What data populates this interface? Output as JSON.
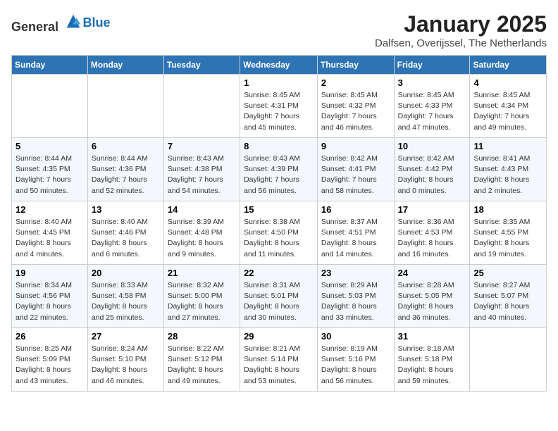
{
  "logo": {
    "general": "General",
    "blue": "Blue"
  },
  "title": "January 2025",
  "location": "Dalfsen, Overijssel, The Netherlands",
  "weekdays": [
    "Sunday",
    "Monday",
    "Tuesday",
    "Wednesday",
    "Thursday",
    "Friday",
    "Saturday"
  ],
  "weeks": [
    [
      {
        "day": "",
        "info": ""
      },
      {
        "day": "",
        "info": ""
      },
      {
        "day": "",
        "info": ""
      },
      {
        "day": "1",
        "info": "Sunrise: 8:45 AM\nSunset: 4:31 PM\nDaylight: 7 hours\nand 45 minutes."
      },
      {
        "day": "2",
        "info": "Sunrise: 8:45 AM\nSunset: 4:32 PM\nDaylight: 7 hours\nand 46 minutes."
      },
      {
        "day": "3",
        "info": "Sunrise: 8:45 AM\nSunset: 4:33 PM\nDaylight: 7 hours\nand 47 minutes."
      },
      {
        "day": "4",
        "info": "Sunrise: 8:45 AM\nSunset: 4:34 PM\nDaylight: 7 hours\nand 49 minutes."
      }
    ],
    [
      {
        "day": "5",
        "info": "Sunrise: 8:44 AM\nSunset: 4:35 PM\nDaylight: 7 hours\nand 50 minutes."
      },
      {
        "day": "6",
        "info": "Sunrise: 8:44 AM\nSunset: 4:36 PM\nDaylight: 7 hours\nand 52 minutes."
      },
      {
        "day": "7",
        "info": "Sunrise: 8:43 AM\nSunset: 4:38 PM\nDaylight: 7 hours\nand 54 minutes."
      },
      {
        "day": "8",
        "info": "Sunrise: 8:43 AM\nSunset: 4:39 PM\nDaylight: 7 hours\nand 56 minutes."
      },
      {
        "day": "9",
        "info": "Sunrise: 8:42 AM\nSunset: 4:41 PM\nDaylight: 7 hours\nand 58 minutes."
      },
      {
        "day": "10",
        "info": "Sunrise: 8:42 AM\nSunset: 4:42 PM\nDaylight: 8 hours\nand 0 minutes."
      },
      {
        "day": "11",
        "info": "Sunrise: 8:41 AM\nSunset: 4:43 PM\nDaylight: 8 hours\nand 2 minutes."
      }
    ],
    [
      {
        "day": "12",
        "info": "Sunrise: 8:40 AM\nSunset: 4:45 PM\nDaylight: 8 hours\nand 4 minutes."
      },
      {
        "day": "13",
        "info": "Sunrise: 8:40 AM\nSunset: 4:46 PM\nDaylight: 8 hours\nand 6 minutes."
      },
      {
        "day": "14",
        "info": "Sunrise: 8:39 AM\nSunset: 4:48 PM\nDaylight: 8 hours\nand 9 minutes."
      },
      {
        "day": "15",
        "info": "Sunrise: 8:38 AM\nSunset: 4:50 PM\nDaylight: 8 hours\nand 11 minutes."
      },
      {
        "day": "16",
        "info": "Sunrise: 8:37 AM\nSunset: 4:51 PM\nDaylight: 8 hours\nand 14 minutes."
      },
      {
        "day": "17",
        "info": "Sunrise: 8:36 AM\nSunset: 4:53 PM\nDaylight: 8 hours\nand 16 minutes."
      },
      {
        "day": "18",
        "info": "Sunrise: 8:35 AM\nSunset: 4:55 PM\nDaylight: 8 hours\nand 19 minutes."
      }
    ],
    [
      {
        "day": "19",
        "info": "Sunrise: 8:34 AM\nSunset: 4:56 PM\nDaylight: 8 hours\nand 22 minutes."
      },
      {
        "day": "20",
        "info": "Sunrise: 8:33 AM\nSunset: 4:58 PM\nDaylight: 8 hours\nand 25 minutes."
      },
      {
        "day": "21",
        "info": "Sunrise: 8:32 AM\nSunset: 5:00 PM\nDaylight: 8 hours\nand 27 minutes."
      },
      {
        "day": "22",
        "info": "Sunrise: 8:31 AM\nSunset: 5:01 PM\nDaylight: 8 hours\nand 30 minutes."
      },
      {
        "day": "23",
        "info": "Sunrise: 8:29 AM\nSunset: 5:03 PM\nDaylight: 8 hours\nand 33 minutes."
      },
      {
        "day": "24",
        "info": "Sunrise: 8:28 AM\nSunset: 5:05 PM\nDaylight: 8 hours\nand 36 minutes."
      },
      {
        "day": "25",
        "info": "Sunrise: 8:27 AM\nSunset: 5:07 PM\nDaylight: 8 hours\nand 40 minutes."
      }
    ],
    [
      {
        "day": "26",
        "info": "Sunrise: 8:25 AM\nSunset: 5:09 PM\nDaylight: 8 hours\nand 43 minutes."
      },
      {
        "day": "27",
        "info": "Sunrise: 8:24 AM\nSunset: 5:10 PM\nDaylight: 8 hours\nand 46 minutes."
      },
      {
        "day": "28",
        "info": "Sunrise: 8:22 AM\nSunset: 5:12 PM\nDaylight: 8 hours\nand 49 minutes."
      },
      {
        "day": "29",
        "info": "Sunrise: 8:21 AM\nSunset: 5:14 PM\nDaylight: 8 hours\nand 53 minutes."
      },
      {
        "day": "30",
        "info": "Sunrise: 8:19 AM\nSunset: 5:16 PM\nDaylight: 8 hours\nand 56 minutes."
      },
      {
        "day": "31",
        "info": "Sunrise: 8:18 AM\nSunset: 5:18 PM\nDaylight: 8 hours\nand 59 minutes."
      },
      {
        "day": "",
        "info": ""
      }
    ]
  ]
}
